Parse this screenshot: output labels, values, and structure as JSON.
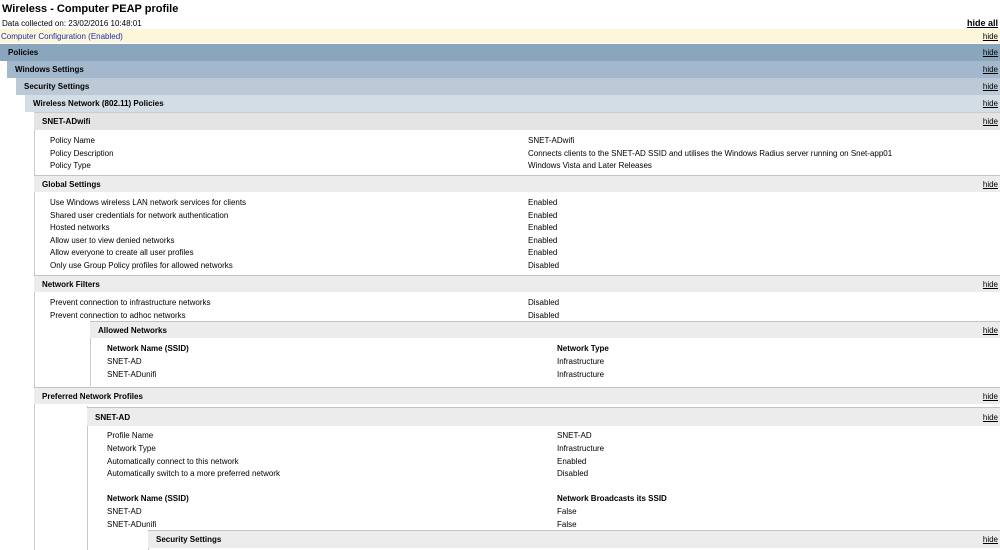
{
  "header": {
    "title": "Wireless - Computer PEAP profile",
    "collected": "Data collected on: 23/02/2016 10:48:01",
    "hide_all": "hide all"
  },
  "hide_label": "hide",
  "bars": {
    "computer_config": "Computer Configuration (Enabled)",
    "policies": "Policies",
    "windows_settings": "Windows Settings",
    "security_settings": "Security Settings",
    "wireless_network": "Wireless Network (802.11) Policies",
    "snet_adwifi": "SNET-ADwifi"
  },
  "policy": {
    "rows": [
      {
        "label": "Policy Name",
        "value": "SNET-ADwifi"
      },
      {
        "label": "Policy Description",
        "value": "Connects clients to the SNET-AD SSID and utilises the Windows Radius server running on Snet-app01"
      },
      {
        "label": "Policy Type",
        "value": "Windows Vista and Later Releases"
      }
    ]
  },
  "global_settings": {
    "title": "Global Settings",
    "rows": [
      {
        "label": "Use Windows wireless LAN network services for clients",
        "value": "Enabled"
      },
      {
        "label": "Shared user credentials for network authentication",
        "value": "Enabled"
      },
      {
        "label": "Hosted networks",
        "value": "Enabled"
      },
      {
        "label": "Allow user to view denied networks",
        "value": "Enabled"
      },
      {
        "label": "Allow everyone to create all user profiles",
        "value": "Enabled"
      },
      {
        "label": "Only use Group Policy profiles for allowed networks",
        "value": "Disabled"
      }
    ]
  },
  "network_filters": {
    "title": "Network Filters",
    "rows": [
      {
        "label": "Prevent connection to infrastructure networks",
        "value": "Disabled"
      },
      {
        "label": "Prevent connection to adhoc networks",
        "value": "Disabled"
      }
    ],
    "allowed": {
      "title": "Allowed Networks",
      "col1": "Network Name (SSID)",
      "col2": "Network Type",
      "rows": [
        {
          "name": "SNET-AD",
          "type": "Infrastructure"
        },
        {
          "name": "SNET-ADunifi",
          "type": "Infrastructure"
        }
      ]
    }
  },
  "preferred": {
    "title": "Preferred Network Profiles",
    "profile_title": "SNET-AD",
    "rows": [
      {
        "label": "Profile Name",
        "value": "SNET-AD"
      },
      {
        "label": "Network Type",
        "value": "Infrastructure"
      },
      {
        "label": "Automatically connect to this network",
        "value": "Enabled"
      },
      {
        "label": "Automatically switch to a more preferred network",
        "value": "Disabled"
      }
    ],
    "col1": "Network Name (SSID)",
    "col2": "Network Broadcasts its SSID",
    "ssids": [
      {
        "name": "SNET-AD",
        "broadcast": "False"
      },
      {
        "name": "SNET-ADunifi",
        "broadcast": "False"
      }
    ],
    "security_settings": "Security Settings"
  }
}
